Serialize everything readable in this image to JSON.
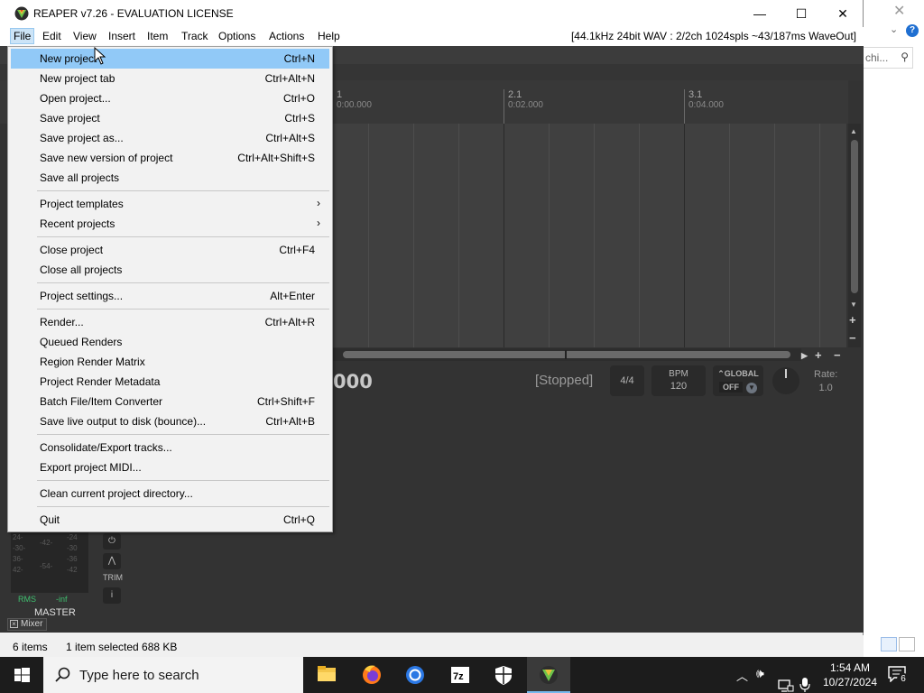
{
  "window": {
    "title": "REAPER v7.26 - EVALUATION LICENSE",
    "minimize": "—",
    "maximize": "☐",
    "close": "✕"
  },
  "menubar": {
    "items": [
      "File",
      "Edit",
      "View",
      "Insert",
      "Item",
      "Track",
      "Options",
      "Actions",
      "Help"
    ],
    "audio_status": "[44.1kHz 24bit WAV : 2/2ch 1024spls ~43/187ms WaveOut]"
  },
  "file_menu": {
    "items": [
      {
        "label": "New project",
        "shortcut": "Ctrl+N",
        "highlighted": true
      },
      {
        "label": "New project tab",
        "shortcut": "Ctrl+Alt+N"
      },
      {
        "label": "Open project...",
        "shortcut": "Ctrl+O"
      },
      {
        "label": "Save project",
        "shortcut": "Ctrl+S"
      },
      {
        "label": "Save project as...",
        "shortcut": "Ctrl+Alt+S"
      },
      {
        "label": "Save new version of project",
        "shortcut": "Ctrl+Alt+Shift+S"
      },
      {
        "label": "Save all projects",
        "shortcut": ""
      },
      {
        "label": "Project templates",
        "submenu": true
      },
      {
        "label": "Recent projects",
        "submenu": true
      },
      {
        "label": "Close project",
        "shortcut": "Ctrl+F4"
      },
      {
        "label": "Close all projects",
        "shortcut": ""
      },
      {
        "label": "Project settings...",
        "shortcut": "Alt+Enter"
      },
      {
        "label": "Render...",
        "shortcut": "Ctrl+Alt+R"
      },
      {
        "label": "Queued Renders",
        "shortcut": ""
      },
      {
        "label": "Region Render Matrix",
        "shortcut": ""
      },
      {
        "label": "Project Render Metadata",
        "shortcut": ""
      },
      {
        "label": "Batch File/Item Converter",
        "shortcut": "Ctrl+Shift+F"
      },
      {
        "label": "Save live output to disk (bounce)...",
        "shortcut": "Ctrl+Alt+B"
      },
      {
        "label": "Consolidate/Export tracks...",
        "shortcut": ""
      },
      {
        "label": "Export project MIDI...",
        "shortcut": ""
      },
      {
        "label": "Clean current project directory...",
        "shortcut": ""
      },
      {
        "label": "Quit",
        "shortcut": "Ctrl+Q"
      }
    ]
  },
  "timeline": {
    "markers": [
      {
        "bar": "1",
        "time": "0:00.000"
      },
      {
        "bar": "2.1",
        "time": "0:02.000"
      },
      {
        "bar": "3.1",
        "time": "0:04.000"
      }
    ]
  },
  "transport": {
    "time_fragment": "000",
    "state": "[Stopped]",
    "time_signature": "4/4",
    "bpm_label": "BPM",
    "bpm_value": "120",
    "global_label": "GLOBAL",
    "global_value": "OFF",
    "rate_label": "Rate:",
    "rate_value": "1.0"
  },
  "mixer": {
    "meter_ticks": [
      "24-",
      "-30-",
      "36-",
      "42-",
      "-42-",
      "-54-",
      "-24",
      "-30",
      "-36",
      "-42"
    ],
    "rms_label": "RMS",
    "rms_value": "-inf",
    "master_label": "MASTER",
    "trim_label": "TRIM",
    "tab_label": "Mixer"
  },
  "statusbar": {
    "items_count": "6 items",
    "selection": "1 item selected  688 KB"
  },
  "background_window": {
    "search_placeholder": "chi..."
  },
  "taskbar": {
    "search_placeholder": "Type here to search",
    "time": "1:54 AM",
    "date": "10/27/2024",
    "notification_count": "6"
  },
  "colors": {
    "menu_highlight": "#91c9f7",
    "dark_panel": "#333333",
    "taskbar": "#1c1c1c",
    "accent": "#76b9ed"
  }
}
